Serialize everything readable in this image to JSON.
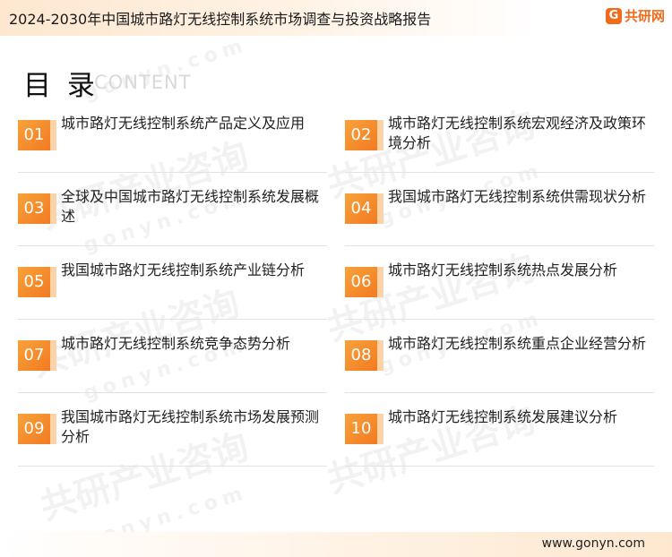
{
  "header": {
    "title": "2024-2030年中国城市路灯无线控制系统市场调查与投资战略报告",
    "logo_mark": "G",
    "logo_text": "共研网"
  },
  "watermark": {
    "brand": "共研产业咨询",
    "site": "gonyn.com"
  },
  "heading": {
    "title": "目 录",
    "subtitle": "CONTENT"
  },
  "toc": {
    "items": [
      {
        "num": "01",
        "label": "城市路灯无线控制系统产品定义及应用"
      },
      {
        "num": "02",
        "label": "城市路灯无线控制系统宏观经济及政策环境分析"
      },
      {
        "num": "03",
        "label": "全球及中国城市路灯无线控制系统发展概述"
      },
      {
        "num": "04",
        "label": "我国城市路灯无线控制系统供需现状分析"
      },
      {
        "num": "05",
        "label": "我国城市路灯无线控制系统产业链分析"
      },
      {
        "num": "06",
        "label": "城市路灯无线控制系统热点发展分析"
      },
      {
        "num": "07",
        "label": "城市路灯无线控制系统竞争态势分析"
      },
      {
        "num": "08",
        "label": "城市路灯无线控制系统重点企业经营分析"
      },
      {
        "num": "09",
        "label": "我国城市路灯无线控制系统市场发展预测分析"
      },
      {
        "num": "10",
        "label": "城市路灯无线控制系统发展建议分析"
      }
    ]
  },
  "footer": {
    "website": "www.gonyn.com"
  }
}
